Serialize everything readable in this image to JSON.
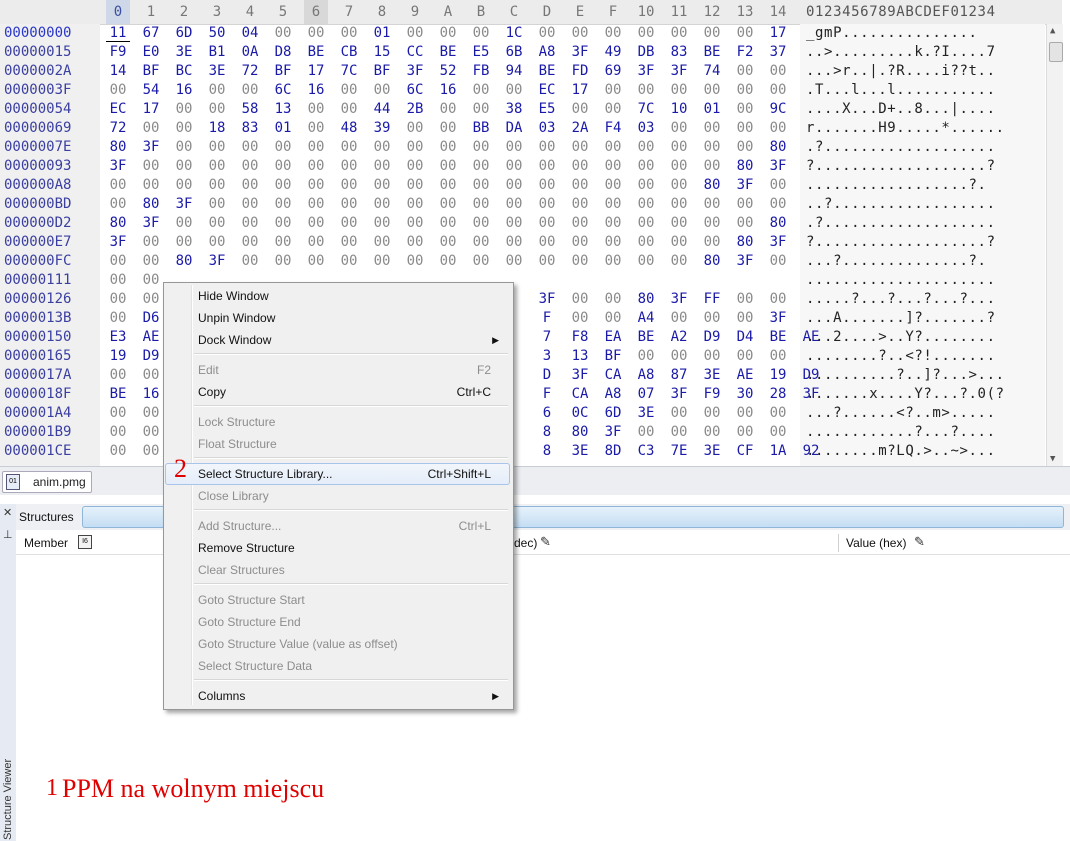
{
  "hex_view": {
    "column_headers": [
      "0",
      "1",
      "2",
      "3",
      "4",
      "5",
      "6",
      "7",
      "8",
      "9",
      "A",
      "B",
      "C",
      "D",
      "E",
      "F",
      "10",
      "11",
      "12",
      "13",
      "14"
    ],
    "ascii_header": "0123456789ABCDEF01234",
    "rows": [
      {
        "offset": "00000000",
        "bytes": [
          "11",
          "67",
          "6D",
          "50",
          "04",
          "00",
          "00",
          "00",
          "01",
          "00",
          "00",
          "00",
          "1C",
          "00",
          "00",
          "00",
          "00",
          "00",
          "00",
          "00",
          "17"
        ],
        "ascii": "_gmP..............."
      },
      {
        "offset": "00000015",
        "bytes": [
          "F9",
          "E0",
          "3E",
          "B1",
          "0A",
          "D8",
          "BE",
          "CB",
          "15",
          "CC",
          "BE",
          "E5",
          "6B",
          "A8",
          "3F",
          "49",
          "DB",
          "83",
          "BE",
          "F2",
          "37"
        ],
        "ascii": "..>.........k.?I....7"
      },
      {
        "offset": "0000002A",
        "bytes": [
          "14",
          "BF",
          "BC",
          "3E",
          "72",
          "BF",
          "17",
          "7C",
          "BF",
          "3F",
          "52",
          "FB",
          "94",
          "BE",
          "FD",
          "69",
          "3F",
          "3F",
          "74",
          "00",
          "00"
        ],
        "ascii": "...>r..|.?R....i??t.."
      },
      {
        "offset": "0000003F",
        "bytes": [
          "00",
          "54",
          "16",
          "00",
          "00",
          "6C",
          "16",
          "00",
          "00",
          "6C",
          "16",
          "00",
          "00",
          "EC",
          "17",
          "00",
          "00",
          "00",
          "00",
          "00",
          "00"
        ],
        "ascii": ".T...l...l..........."
      },
      {
        "offset": "00000054",
        "bytes": [
          "EC",
          "17",
          "00",
          "00",
          "58",
          "13",
          "00",
          "00",
          "44",
          "2B",
          "00",
          "00",
          "38",
          "E5",
          "00",
          "00",
          "7C",
          "10",
          "01",
          "00",
          "9C"
        ],
        "ascii": "....X...D+..8...|...."
      },
      {
        "offset": "00000069",
        "bytes": [
          "72",
          "00",
          "00",
          "18",
          "83",
          "01",
          "00",
          "48",
          "39",
          "00",
          "00",
          "BB",
          "DA",
          "03",
          "2A",
          "F4",
          "03",
          "00",
          "00",
          "00",
          "00"
        ],
        "ascii": "r.......H9.....*......"
      },
      {
        "offset": "0000007E",
        "bytes": [
          "80",
          "3F",
          "00",
          "00",
          "00",
          "00",
          "00",
          "00",
          "00",
          "00",
          "00",
          "00",
          "00",
          "00",
          "00",
          "00",
          "00",
          "00",
          "00",
          "00",
          "80"
        ],
        "ascii": ".?..................."
      },
      {
        "offset": "00000093",
        "bytes": [
          "3F",
          "00",
          "00",
          "00",
          "00",
          "00",
          "00",
          "00",
          "00",
          "00",
          "00",
          "00",
          "00",
          "00",
          "00",
          "00",
          "00",
          "00",
          "00",
          "80",
          "3F"
        ],
        "ascii": "?...................?"
      },
      {
        "offset": "000000A8",
        "bytes": [
          "00",
          "00",
          "00",
          "00",
          "00",
          "00",
          "00",
          "00",
          "00",
          "00",
          "00",
          "00",
          "00",
          "00",
          "00",
          "00",
          "00",
          "00",
          "80",
          "3F",
          "00"
        ],
        "ascii": "..................?."
      },
      {
        "offset": "000000BD",
        "bytes": [
          "00",
          "80",
          "3F",
          "00",
          "00",
          "00",
          "00",
          "00",
          "00",
          "00",
          "00",
          "00",
          "00",
          "00",
          "00",
          "00",
          "00",
          "00",
          "00",
          "00",
          "00"
        ],
        "ascii": "..?.................."
      },
      {
        "offset": "000000D2",
        "bytes": [
          "80",
          "3F",
          "00",
          "00",
          "00",
          "00",
          "00",
          "00",
          "00",
          "00",
          "00",
          "00",
          "00",
          "00",
          "00",
          "00",
          "00",
          "00",
          "00",
          "00",
          "80"
        ],
        "ascii": ".?..................."
      },
      {
        "offset": "000000E7",
        "bytes": [
          "3F",
          "00",
          "00",
          "00",
          "00",
          "00",
          "00",
          "00",
          "00",
          "00",
          "00",
          "00",
          "00",
          "00",
          "00",
          "00",
          "00",
          "00",
          "00",
          "80",
          "3F"
        ],
        "ascii": "?...................?"
      },
      {
        "offset": "000000FC",
        "bytes": [
          "00",
          "00",
          "80",
          "3F",
          "00",
          "00",
          "00",
          "00",
          "00",
          "00",
          "00",
          "00",
          "00",
          "00",
          "00",
          "00",
          "00",
          "00",
          "80",
          "3F",
          "00"
        ],
        "ascii": "...?..............?."
      },
      {
        "offset": "00000111",
        "bytes": [
          "00",
          "00",
          "",
          "",
          "",
          "",
          "",
          "",
          "",
          "",
          "",
          "",
          "",
          "",
          "",
          "",
          "",
          "",
          "",
          "",
          ""
        ],
        "ascii": "....................."
      },
      {
        "offset": "00000126",
        "bytes": [
          "00",
          "00",
          "",
          "",
          "",
          "",
          "",
          "",
          "",
          "",
          "",
          "",
          "",
          "3F",
          "00",
          "00",
          "80",
          "3F",
          "FF",
          "00",
          "00"
        ],
        "ascii": ".....?...?...?...?..."
      },
      {
        "offset": "0000013B",
        "bytes": [
          "00",
          "D6",
          "",
          "",
          "",
          "",
          "",
          "",
          "",
          "",
          "",
          "",
          "",
          "F",
          "00",
          "00",
          "A4",
          "00",
          "00",
          "00",
          "3F"
        ],
        "ascii": "...A.......]?.......?"
      },
      {
        "offset": "00000150",
        "bytes": [
          "E3",
          "AE",
          "",
          "",
          "",
          "",
          "",
          "",
          "",
          "",
          "",
          "",
          "",
          "7",
          "F8",
          "EA",
          "BE",
          "A2",
          "D9",
          "D4",
          "BE",
          "AE"
        ],
        "ascii": "...2....>..Y?........"
      },
      {
        "offset": "00000165",
        "bytes": [
          "19",
          "D9",
          "",
          "",
          "",
          "",
          "",
          "",
          "",
          "",
          "",
          "",
          "",
          "3",
          "13",
          "BF",
          "00",
          "00",
          "00",
          "00",
          "00"
        ],
        "ascii": "........?..<?!......."
      },
      {
        "offset": "0000017A",
        "bytes": [
          "00",
          "00",
          "",
          "",
          "",
          "",
          "",
          "",
          "",
          "",
          "",
          "",
          "",
          "D",
          "3F",
          "CA",
          "A8",
          "87",
          "3E",
          "AE",
          "19",
          "D9"
        ],
        "ascii": "..........?..]?...>..."
      },
      {
        "offset": "0000018F",
        "bytes": [
          "BE",
          "16",
          "",
          "",
          "",
          "",
          "",
          "",
          "",
          "",
          "",
          "",
          "",
          "F",
          "CA",
          "A8",
          "07",
          "3F",
          "F9",
          "30",
          "28",
          "3F"
        ],
        "ascii": ".......x....Y?...?.0(?"
      },
      {
        "offset": "000001A4",
        "bytes": [
          "00",
          "00",
          "",
          "",
          "",
          "",
          "",
          "",
          "",
          "",
          "",
          "",
          "",
          "6",
          "0C",
          "6D",
          "3E",
          "00",
          "00",
          "00",
          "00"
        ],
        "ascii": "...?......<?..m>....."
      },
      {
        "offset": "000001B9",
        "bytes": [
          "00",
          "00",
          "",
          "",
          "",
          "",
          "",
          "",
          "",
          "",
          "",
          "",
          "",
          "8",
          "80",
          "3F",
          "00",
          "00",
          "00",
          "00",
          "00"
        ],
        "ascii": "............?...?...."
      },
      {
        "offset": "000001CE",
        "bytes": [
          "00",
          "00",
          "",
          "",
          "",
          "",
          "",
          "",
          "",
          "",
          "",
          "",
          "",
          "8",
          "3E",
          "8D",
          "C3",
          "7E",
          "3E",
          "CF",
          "1A",
          "92"
        ],
        "ascii": "........m?LQ.>..~>..."
      }
    ]
  },
  "doc_tab": {
    "label": "anim.pmg"
  },
  "structures_panel": {
    "tab_label": "Structures",
    "col_member": "Member",
    "col_dec": "(dec)",
    "col_hex": "Value (hex)",
    "side_label": "Structure Viewer"
  },
  "context_menu": {
    "items": [
      {
        "label": "Hide Window",
        "shortcut": "",
        "disabled": false,
        "submenu": false
      },
      {
        "label": "Unpin Window",
        "shortcut": "",
        "disabled": false,
        "submenu": false
      },
      {
        "label": "Dock Window",
        "shortcut": "",
        "disabled": false,
        "submenu": true
      },
      {
        "label": "Edit",
        "shortcut": "F2",
        "disabled": true,
        "submenu": false
      },
      {
        "label": "Copy",
        "shortcut": "Ctrl+C",
        "disabled": false,
        "submenu": false
      },
      {
        "label": "Lock Structure",
        "shortcut": "",
        "disabled": true,
        "submenu": false
      },
      {
        "label": "Float Structure",
        "shortcut": "",
        "disabled": true,
        "submenu": false
      },
      {
        "label": "Select Structure Library...",
        "shortcut": "Ctrl+Shift+L",
        "disabled": false,
        "submenu": false
      },
      {
        "label": "Close Library",
        "shortcut": "",
        "disabled": true,
        "submenu": false
      },
      {
        "label": "Add Structure...",
        "shortcut": "Ctrl+L",
        "disabled": true,
        "submenu": false
      },
      {
        "label": "Remove Structure",
        "shortcut": "",
        "disabled": false,
        "submenu": false
      },
      {
        "label": "Clear Structures",
        "shortcut": "",
        "disabled": true,
        "submenu": false
      },
      {
        "label": "Goto Structure Start",
        "shortcut": "",
        "disabled": true,
        "submenu": false
      },
      {
        "label": "Goto Structure End",
        "shortcut": "",
        "disabled": true,
        "submenu": false
      },
      {
        "label": "Goto Structure Value (value as offset)",
        "shortcut": "",
        "disabled": true,
        "submenu": false
      },
      {
        "label": "Select Structure Data",
        "shortcut": "",
        "disabled": true,
        "submenu": false
      },
      {
        "label": "Columns",
        "shortcut": "",
        "disabled": false,
        "submenu": true
      }
    ]
  },
  "annotations": {
    "step1_number": "1",
    "step1_text": "PPM na wolnym miejscu",
    "step2_number": "2"
  },
  "colors": {
    "annotation": "#e00000",
    "hex_value": "#1a1aa8",
    "offset": "#3a3fa0"
  }
}
